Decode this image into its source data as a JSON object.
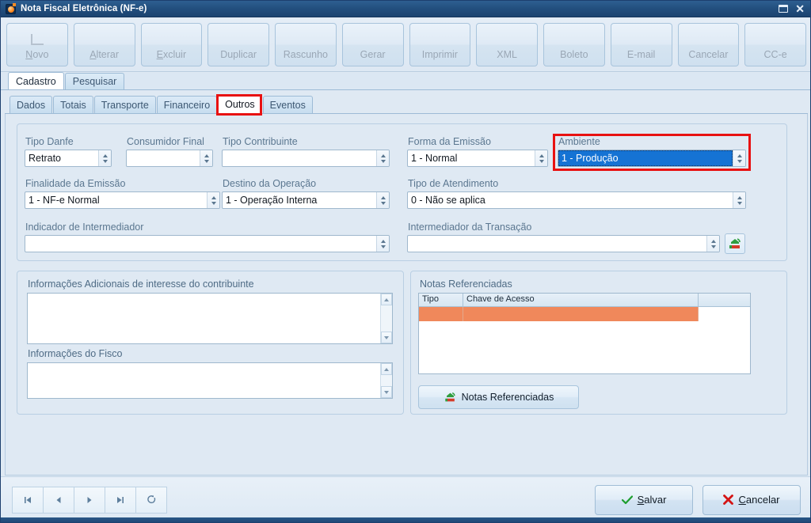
{
  "window": {
    "title": "Nota Fiscal Eletrônica (NF-e)",
    "icon": "nfe-app-icon",
    "restore_label": "❐",
    "close_label": "✕"
  },
  "toolbar": {
    "buttons": [
      {
        "label": "Novo",
        "accel": "N"
      },
      {
        "label": "Alterar",
        "accel": "A"
      },
      {
        "label": "Excluir",
        "accel": "E"
      },
      {
        "label": "Duplicar",
        "accel": ""
      },
      {
        "label": "Rascunho",
        "accel": ""
      },
      {
        "label": "Gerar",
        "accel": ""
      },
      {
        "label": "Imprimir",
        "accel": ""
      },
      {
        "label": "XML",
        "accel": ""
      },
      {
        "label": "Boleto",
        "accel": ""
      },
      {
        "label": "E-mail",
        "accel": ""
      },
      {
        "label": "Cancelar",
        "accel": ""
      },
      {
        "label": "CC-e",
        "accel": ""
      }
    ]
  },
  "outer_tabs": {
    "items": [
      {
        "label": "Cadastro",
        "active": true
      },
      {
        "label": "Pesquisar",
        "active": false
      }
    ]
  },
  "inner_tabs": {
    "items": [
      {
        "label": "Dados",
        "active": false
      },
      {
        "label": "Totais",
        "active": false
      },
      {
        "label": "Transporte",
        "active": false
      },
      {
        "label": "Financeiro",
        "active": false
      },
      {
        "label": "Outros",
        "active": true
      },
      {
        "label": "Eventos",
        "active": false
      }
    ]
  },
  "form": {
    "tipo_danfe": {
      "label": "Tipo Danfe",
      "value": "Retrato"
    },
    "consumidor_final": {
      "label": "Consumidor Final",
      "value": ""
    },
    "tipo_contribuinte": {
      "label": "Tipo Contribuinte",
      "value": ""
    },
    "forma_emissao": {
      "label": "Forma da Emissão",
      "value": "1 - Normal"
    },
    "ambiente": {
      "label": "Ambiente",
      "value": "1 - Produção",
      "selected": true,
      "highlight_color": "#e81111"
    },
    "finalidade_emissao": {
      "label": "Finalidade da Emissão",
      "value": "1 - NF-e Normal"
    },
    "destino_operacao": {
      "label": "Destino da Operação",
      "value": "1 - Operação Interna"
    },
    "tipo_atendimento": {
      "label": "Tipo de Atendimento",
      "value": "0 - Não se aplica"
    },
    "indicador_intermediador": {
      "label": "Indicador de Intermediador",
      "value": ""
    },
    "intermediador_transacao": {
      "label": "Intermediador da Transação",
      "value": "",
      "lookup_icon": "lookup-icon"
    }
  },
  "info_panel": {
    "adicionais": {
      "label": "Informações Adicionais de interesse do contribuinte",
      "value": ""
    },
    "fisco": {
      "label": "Informações do Fisco",
      "value": ""
    }
  },
  "notas_panel": {
    "title": "Notas Referenciadas",
    "grid": {
      "columns": [
        "Tipo",
        "Chave de Acesso"
      ],
      "rows": [
        {
          "tipo": "",
          "chave": "",
          "selected": true
        }
      ]
    },
    "button": {
      "label": "Notas Referenciadas",
      "icon": "notas-icon"
    }
  },
  "footer": {
    "nav": [
      {
        "name": "first",
        "glyph": "first-record-icon"
      },
      {
        "name": "prev",
        "glyph": "prev-record-icon"
      },
      {
        "name": "next",
        "glyph": "next-record-icon"
      },
      {
        "name": "last",
        "glyph": "last-record-icon"
      },
      {
        "name": "refresh",
        "glyph": "refresh-icon"
      }
    ],
    "save": {
      "label": "Salvar",
      "accel": "S",
      "icon": "check-icon",
      "color": "#1e9e2e"
    },
    "cancel": {
      "label": "Cancelar",
      "accel": "C",
      "icon": "x-icon",
      "color": "#d41414"
    }
  }
}
